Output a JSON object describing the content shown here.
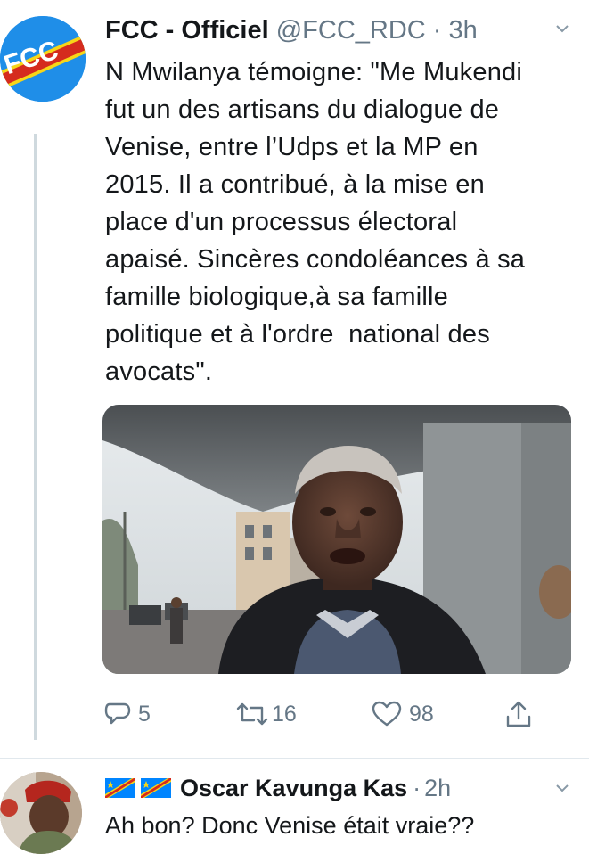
{
  "tweet": {
    "author_name": "FCC - Officiel",
    "handle": "@FCC_RDC",
    "separator": "·",
    "time": "3h",
    "avatar_text": "FCC",
    "text": "N Mwilanya témoigne: \"Me Mukendi\nfut un des artisans du dialogue de\nVenise, entre l’Udps et la MP en\n2015. Il a contribué, à la mise en\nplace d'un processus électoral\napaisé. Sincères condoléances à sa\nfamille biologique,à sa famille\npolitique et à l'ordre  national des\navocats\".",
    "actions": {
      "reply_count": "5",
      "retweet_count": "16",
      "like_count": "98"
    },
    "icons": [
      "reply-icon",
      "retweet-icon",
      "like-icon",
      "share-icon",
      "chevron-down-icon"
    ]
  },
  "reply": {
    "author_name": "Oscar Kavunga Kas",
    "separator": "·",
    "time": "2h",
    "text": "Ah bon? Donc Venise était vraie??",
    "flags": [
      "drc-flag-icon",
      "drc-flag-icon"
    ]
  },
  "colors": {
    "primary_text": "#14171a",
    "secondary_text": "#657786",
    "avatar_blue": "#1f8ee8",
    "flag_blue": "#0085ff",
    "flag_red": "#d52b1e",
    "flag_yellow": "#f7d618"
  }
}
